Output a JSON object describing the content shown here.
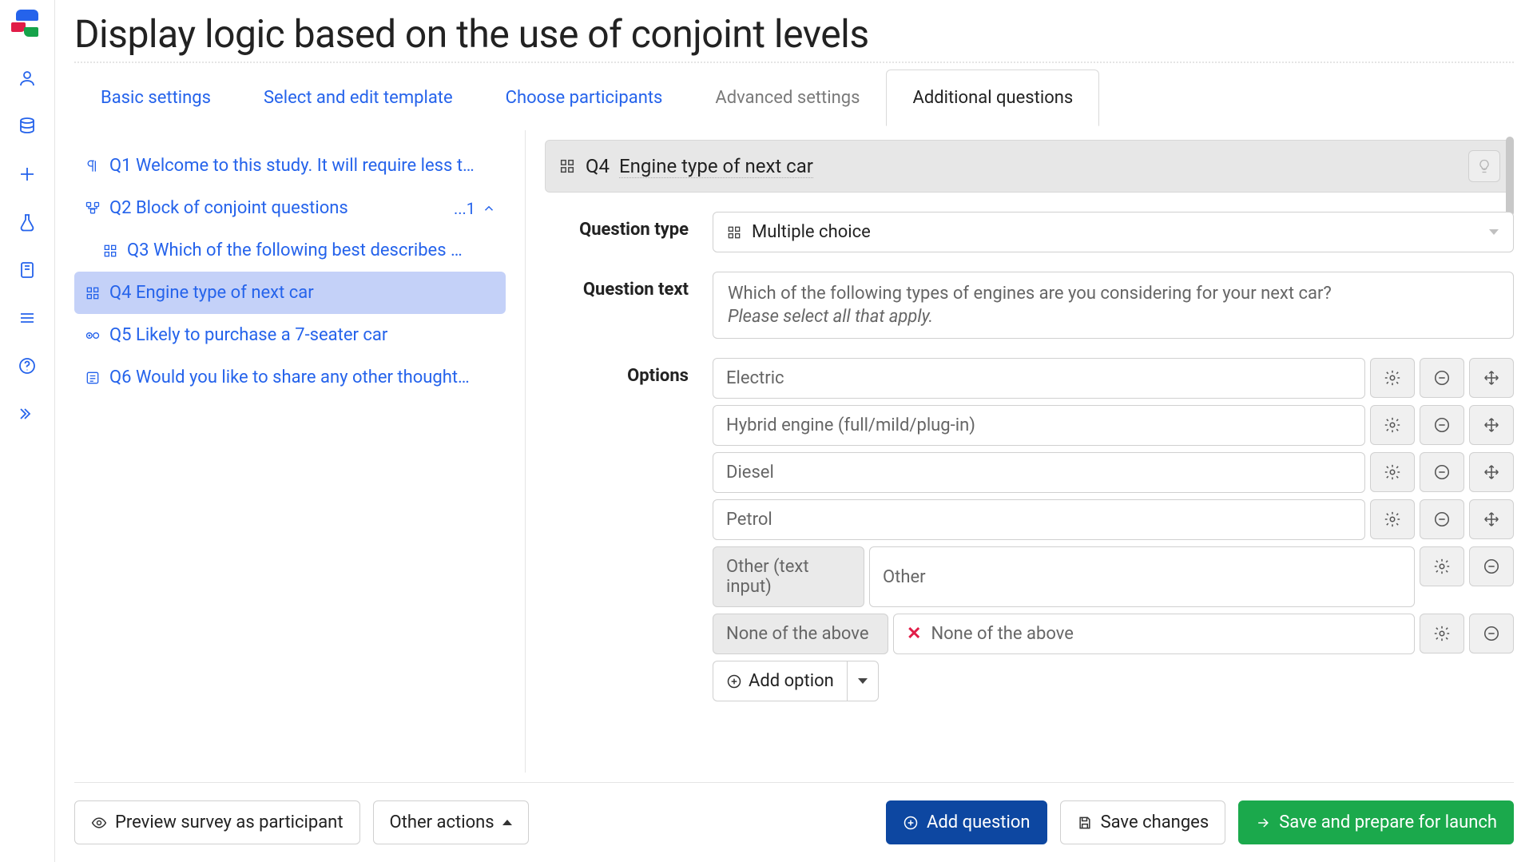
{
  "page": {
    "title": "Display logic based on the use of conjoint levels"
  },
  "tabs": {
    "basic": {
      "label": "Basic settings"
    },
    "template": {
      "label": "Select and edit template"
    },
    "participants": {
      "label": "Choose participants"
    },
    "advanced": {
      "label": "Advanced settings"
    },
    "additional": {
      "label": "Additional questions"
    }
  },
  "question_list": {
    "q1": {
      "code": "Q1",
      "label": "Welcome to this study. It will require less t…"
    },
    "q2": {
      "code": "Q2",
      "label": "Block of conjoint questions",
      "meta": "...1"
    },
    "q3": {
      "code": "Q3",
      "label": "Which of the following best describes …"
    },
    "q4": {
      "code": "Q4",
      "label": "Engine type of next car"
    },
    "q5": {
      "code": "Q5",
      "label": "Likely to purchase a 7-seater car"
    },
    "q6": {
      "code": "Q6",
      "label": "Would you like to share any other thought…"
    }
  },
  "editor": {
    "header": {
      "code": "Q4",
      "title": "Engine type of next car"
    },
    "question_type": {
      "label": "Question type",
      "value": "Multiple choice"
    },
    "question_text": {
      "label": "Question text",
      "line1": "Which of the following types of engines are you considering for your next car?",
      "line2": "Please select all that apply."
    },
    "options": {
      "label": "Options",
      "rows": [
        "Electric",
        "Hybrid engine (full/mild/plug-in)",
        "Diesel",
        "Petrol"
      ],
      "other": {
        "tag": "Other (text input)",
        "value": "Other"
      },
      "none": {
        "tag": "None of the above",
        "value": "None of the above"
      },
      "add_label": "Add option"
    }
  },
  "footer": {
    "preview": "Preview survey as participant",
    "other": "Other actions",
    "add": "Add question",
    "save": "Save changes",
    "launch": "Save and prepare for launch"
  }
}
